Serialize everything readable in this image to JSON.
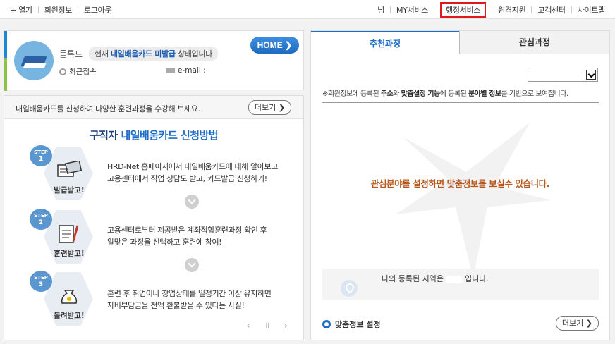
{
  "topbar": {
    "left_links": [
      "+ 열기",
      "회원정보",
      "로그아웃"
    ],
    "user_suffix": "님",
    "right_links": [
      "MY서비스",
      "행정서비스",
      "원격지원",
      "고객센터",
      "사이트맵"
    ]
  },
  "profile": {
    "name": "듣톡드",
    "status_prefix": "현재 ",
    "status_highlight": "내일배움카드 미발급",
    "status_suffix": " 상태입니다",
    "recent_label": "최근접속",
    "email_label": "e-mail :",
    "home_label": "HOME ❯"
  },
  "card": {
    "header_text": "내일배움카드를 신청하여 다양한 훈련과정을 수강해 보세요.",
    "more_label": "더보기 ❯",
    "title_prefix": "구직자 ",
    "title_highlight": "내일배움카드 신청방법",
    "steps": [
      {
        "badge": "STEP",
        "num": "1",
        "label": "발급받고!",
        "line1": "HRD-Net 홈페이지에서 내일배움카드에 대해 알아보고",
        "line2": "고용센터에서 직업 상담도 받고, 카드발급 신청하기!"
      },
      {
        "badge": "STEP",
        "num": "2",
        "label": "훈련받고!",
        "line1": "고용센터로부터 제공받은 계좌적합훈련과정 확인 후",
        "line2": "알맞은 과정을 선택하고 훈련에 참여!"
      },
      {
        "badge": "STEP",
        "num": "3",
        "label": "돌려받고!",
        "line1": "훈련 후 취업이나 창업상태를 일정기간 이상 유지하면",
        "line2": "자비부담금을 전액 환불받을 수 있다는 사실!"
      }
    ],
    "pager": "‹ ॥ ›"
  },
  "right": {
    "tabs": [
      "추천과정",
      "관심과정"
    ],
    "note_parts": [
      "※회원정보에 등록된 ",
      "주소",
      "와 ",
      "맞춤설정 기능",
      "에 등록된 ",
      "분야별 정보",
      "를 기반으로 보여집니다."
    ],
    "center_msg": "관심분야를 설정하면 맞춤정보를 보실수 있습니다.",
    "region_prefix": "나의 등록된 지역은",
    "region_suffix": "입니다.",
    "settings_label": "맞춤정보 설정",
    "more_label": "더보기 ❯"
  },
  "colors": {
    "accent": "#1d6cc8",
    "highlight_border": "#e0191f",
    "message": "#b8581f"
  }
}
